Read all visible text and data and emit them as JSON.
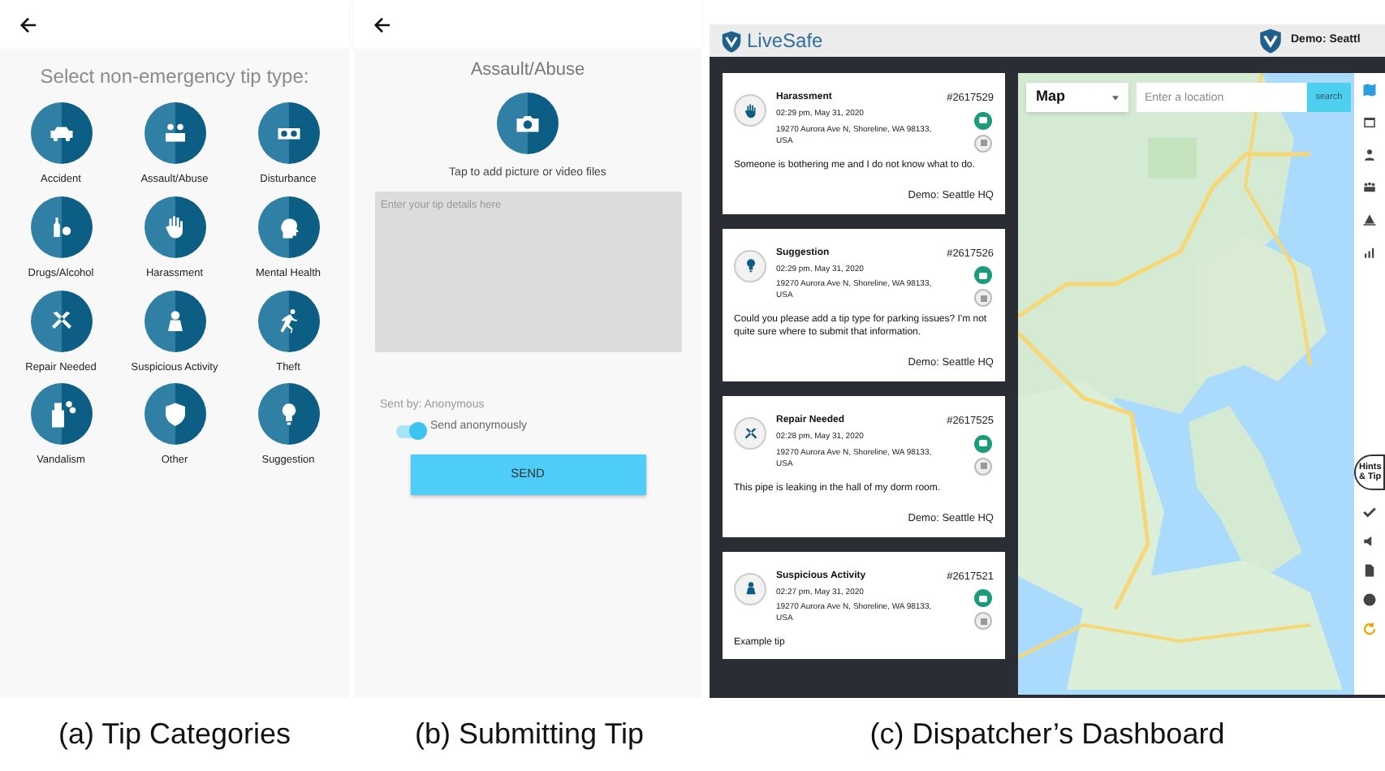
{
  "tip_categories": {
    "title": "Select non-emergency tip type:",
    "categories": [
      {
        "label": "Accident"
      },
      {
        "label": "Assault/Abuse"
      },
      {
        "label": "Disturbance"
      },
      {
        "label": "Drugs/Alcohol"
      },
      {
        "label": "Harassment"
      },
      {
        "label": "Mental Health"
      },
      {
        "label": "Repair Needed"
      },
      {
        "label": "Suspicious Activity"
      },
      {
        "label": "Theft"
      },
      {
        "label": "Vandalism"
      },
      {
        "label": "Other"
      },
      {
        "label": "Suggestion"
      }
    ]
  },
  "submit_tip": {
    "title": "Assault/Abuse",
    "media_hint": "Tap to add picture or video files",
    "details": {
      "placeholder": "Enter your tip details here"
    },
    "sent_by": "Sent by: Anonymous",
    "anonymous_toggle": {
      "label": "Send anonymously",
      "on": true
    },
    "send_button": "SEND"
  },
  "dashboard": {
    "brand": "LiveSafe",
    "user": "Demo: Seattl",
    "tips": [
      {
        "category": "Harassment",
        "time": "02:29 pm, May 31, 2020",
        "address": "19270 Aurora Ave N, Shoreline, WA 98133, USA",
        "id": "#2617529",
        "description": "Someone is bothering me and I do not know what to do.",
        "organization": "Demo: Seattle HQ"
      },
      {
        "category": "Suggestion",
        "time": "02:29 pm, May 31, 2020",
        "address": "19270 Aurora Ave N, Shoreline, WA 98133, USA",
        "id": "#2617526",
        "description": "Could you please add a tip type for parking issues? I'm not quite sure where to submit that information.",
        "organization": "Demo: Seattle HQ"
      },
      {
        "category": "Repair Needed",
        "time": "02:28 pm, May 31, 2020",
        "address": "19270 Aurora Ave N, Shoreline, WA 98133, USA",
        "id": "#2617525",
        "description": "This pipe is leaking in the hall of my dorm room.",
        "organization": "Demo: Seattle HQ"
      },
      {
        "category": "Suspicious Activity",
        "time": "02:27 pm, May 31, 2020",
        "address": "19270 Aurora Ave N, Shoreline, WA 98133, USA",
        "id": "#2617521",
        "description": "Example tip"
      }
    ],
    "map": {
      "kind": "picture",
      "layer_select": "Map",
      "location": {
        "placeholder": "Enter a location"
      },
      "search_button": "search"
    },
    "tools": [
      {
        "selected": true
      },
      {
        "selected": false
      },
      {
        "selected": false
      },
      {
        "selected": false
      },
      {
        "selected": false
      },
      {
        "selected": false
      }
    ],
    "hints": "Hints & Tip"
  },
  "captions": [
    "(a) Tip Categories",
    "(b) Submitting Tip",
    "(c) Dispatcher’s Dashboard"
  ]
}
